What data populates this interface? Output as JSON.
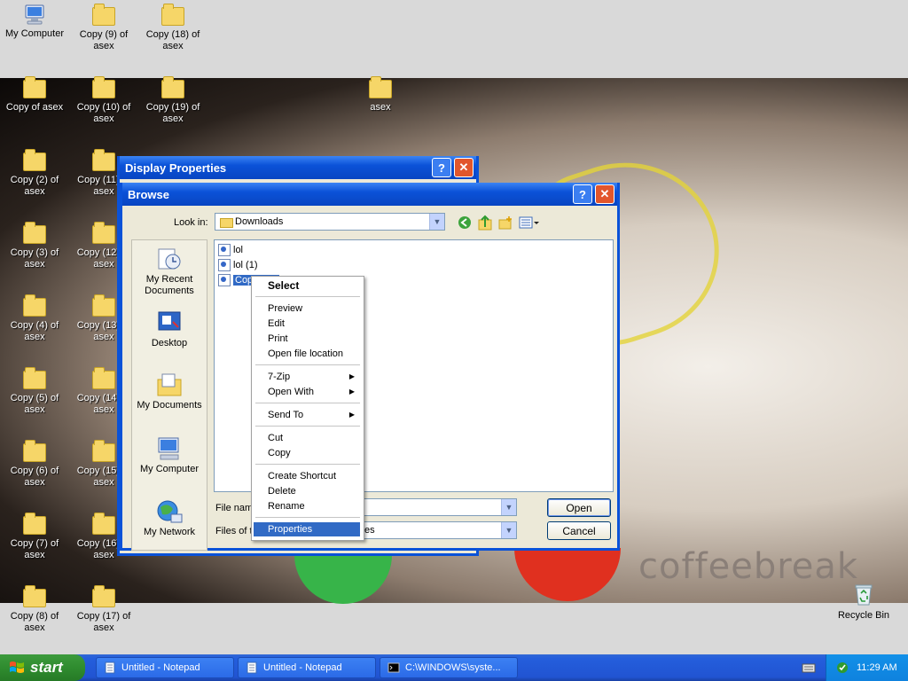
{
  "desktop": {
    "icons": [
      {
        "id": "my-computer",
        "label": "My Computer",
        "type": "computer"
      },
      {
        "id": "copy9",
        "label": "Copy (9) of asex",
        "type": "folder"
      },
      {
        "id": "copy18",
        "label": "Copy (18) of asex",
        "type": "folder"
      },
      {
        "id": "copyof",
        "label": "Copy of asex",
        "type": "folder"
      },
      {
        "id": "copy10",
        "label": "Copy (10) of asex",
        "type": "folder"
      },
      {
        "id": "copy19",
        "label": "Copy (19) of asex",
        "type": "folder"
      },
      {
        "id": "asex",
        "label": "asex",
        "type": "folder"
      },
      {
        "id": "copy2",
        "label": "Copy (2) of asex",
        "type": "folder"
      },
      {
        "id": "copy11",
        "label": "Copy (11) of asex",
        "type": "folder"
      },
      {
        "id": "copy3",
        "label": "Copy (3) of asex",
        "type": "folder"
      },
      {
        "id": "copy12",
        "label": "Copy (12) of asex",
        "type": "folder"
      },
      {
        "id": "copy4",
        "label": "Copy (4) of asex",
        "type": "folder"
      },
      {
        "id": "copy13",
        "label": "Copy (13) of asex",
        "type": "folder"
      },
      {
        "id": "copy5",
        "label": "Copy (5) of asex",
        "type": "folder"
      },
      {
        "id": "copy14",
        "label": "Copy (14) of asex",
        "type": "folder"
      },
      {
        "id": "copy6",
        "label": "Copy (6) of asex",
        "type": "folder"
      },
      {
        "id": "copy15",
        "label": "Copy (15) of asex",
        "type": "folder"
      },
      {
        "id": "copy7",
        "label": "Copy (7) of asex",
        "type": "folder"
      },
      {
        "id": "copy16",
        "label": "Copy (16) of asex",
        "type": "folder"
      },
      {
        "id": "copy8",
        "label": "Copy (8) of asex",
        "type": "folder"
      },
      {
        "id": "copy17",
        "label": "Copy (17) of asex",
        "type": "folder"
      },
      {
        "id": "recycle",
        "label": "Recycle Bin",
        "type": "recycle"
      }
    ],
    "wallpaper_text": "coffeebreak"
  },
  "display_properties": {
    "title": "Display Properties"
  },
  "browse": {
    "title": "Browse",
    "look_in_label": "Look in:",
    "look_in_value": "Downloads",
    "places": [
      "My Recent Documents",
      "Desktop",
      "My Documents",
      "My Computer",
      "My Network"
    ],
    "files": [
      "lol",
      "lol (1)",
      "Copy of lol"
    ],
    "selected_file_visible": "Copy",
    "file_name_label": "File name",
    "files_of_type_label": "Files of ty",
    "files_of_type_value": "es",
    "open_label": "Open",
    "cancel_label": "Cancel"
  },
  "context_menu": {
    "items": [
      {
        "label": "Select",
        "bold": true
      },
      {
        "sep": true
      },
      {
        "label": "Preview"
      },
      {
        "label": "Edit"
      },
      {
        "label": "Print"
      },
      {
        "label": "Open file location"
      },
      {
        "sep": true
      },
      {
        "label": "7-Zip",
        "submenu": true
      },
      {
        "label": "Open With",
        "submenu": true
      },
      {
        "sep": true
      },
      {
        "label": "Send To",
        "submenu": true
      },
      {
        "sep": true
      },
      {
        "label": "Cut"
      },
      {
        "label": "Copy"
      },
      {
        "sep": true
      },
      {
        "label": "Create Shortcut"
      },
      {
        "label": "Delete"
      },
      {
        "label": "Rename"
      },
      {
        "sep": true
      },
      {
        "label": "Properties",
        "highlighted": true
      }
    ]
  },
  "taskbar": {
    "start_label": "start",
    "tasks": [
      "Untitled - Notepad",
      "Untitled - Notepad",
      "C:\\WINDOWS\\syste..."
    ],
    "clock": "11:29 AM"
  },
  "colors": {
    "accent": "#0a52d8",
    "selection": "#316ac5",
    "start_green": "#2f8c2f"
  }
}
